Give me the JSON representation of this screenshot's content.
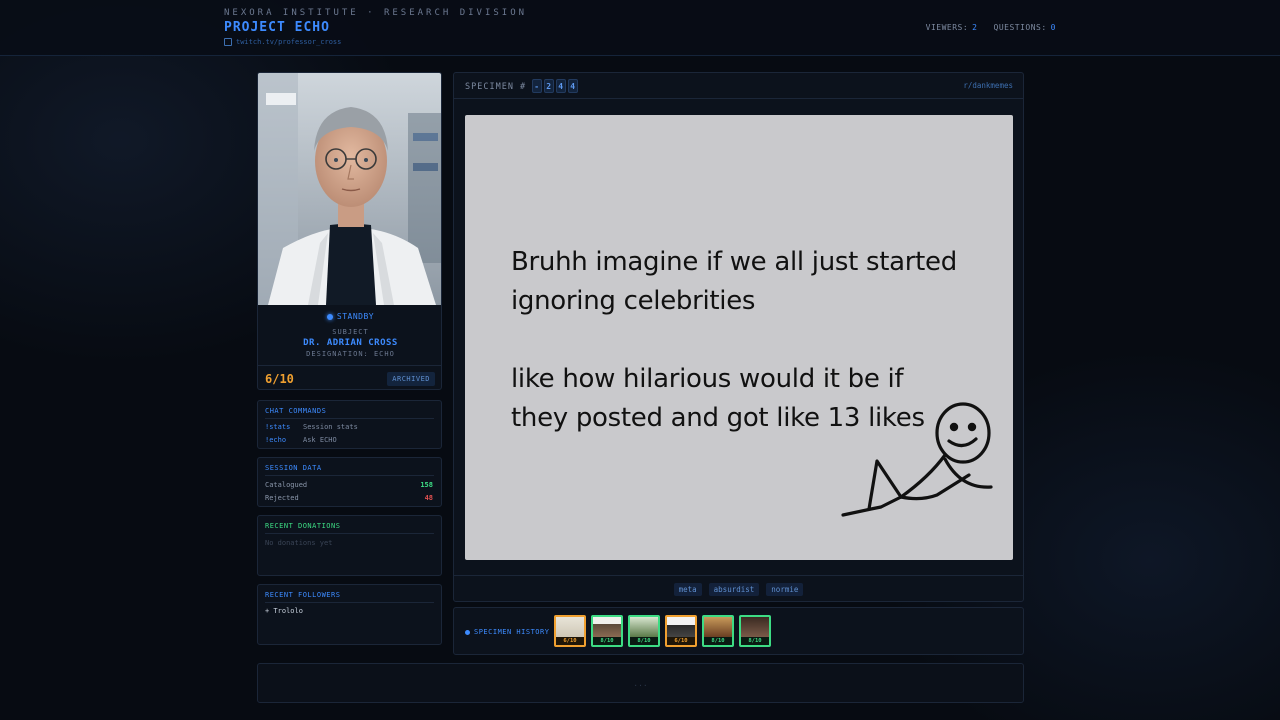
{
  "header": {
    "kicker": "NEXORA INSTITUTE · RESEARCH DIVISION",
    "title": "PROJECT ECHO",
    "link": "twitch.tv/professor_cross",
    "viewers_label": "VIEWERS:",
    "viewers": "2",
    "questions_label": "QUESTIONS:",
    "questions": "0"
  },
  "subject": {
    "status": "STANDBY",
    "label": "SUBJECT",
    "name": "DR. ADRIAN CROSS",
    "designation": "DESIGNATION: ECHO",
    "score": "6/10",
    "badge": "ARCHIVED"
  },
  "commands": {
    "title": "CHAT COMMANDS",
    "items": [
      {
        "cmd": "!stats",
        "desc": "Session stats"
      },
      {
        "cmd": "!echo",
        "desc": "Ask ECHO"
      }
    ]
  },
  "session": {
    "title": "SESSION DATA",
    "catalogued_label": "Catalogued",
    "catalogued": "158",
    "rejected_label": "Rejected",
    "rejected": "48"
  },
  "donations": {
    "title": "RECENT DONATIONS",
    "empty": "No donations yet"
  },
  "followers": {
    "title": "RECENT FOLLOWERS",
    "items": [
      "+ Trololo"
    ]
  },
  "specimen": {
    "label": "SPECIMEN #",
    "digits": [
      "-",
      "2",
      "4",
      "4"
    ],
    "subreddit": "r/dankmemes",
    "meme_line1": "Bruhh imagine if we all just started",
    "meme_line2": "ignoring celebrities",
    "meme_line3": "like how hilarious would it be if",
    "meme_line4": "they posted and got like 13 likes",
    "tags": [
      "meta",
      "absurdist",
      "normie"
    ]
  },
  "history": {
    "label": "SPECIMEN HISTORY",
    "items": [
      {
        "score": "6/10",
        "color": "orange"
      },
      {
        "score": "8/10",
        "color": "green"
      },
      {
        "score": "8/10",
        "color": "green"
      },
      {
        "score": "6/10",
        "color": "orange"
      },
      {
        "score": "8/10",
        "color": "green"
      },
      {
        "score": "8/10",
        "color": "green"
      }
    ]
  },
  "footer": {
    "text": "..."
  },
  "colors": {
    "accent": "#3d8bff",
    "score": "#f0a030",
    "good": "#3ddc84",
    "bad": "#e05050"
  }
}
